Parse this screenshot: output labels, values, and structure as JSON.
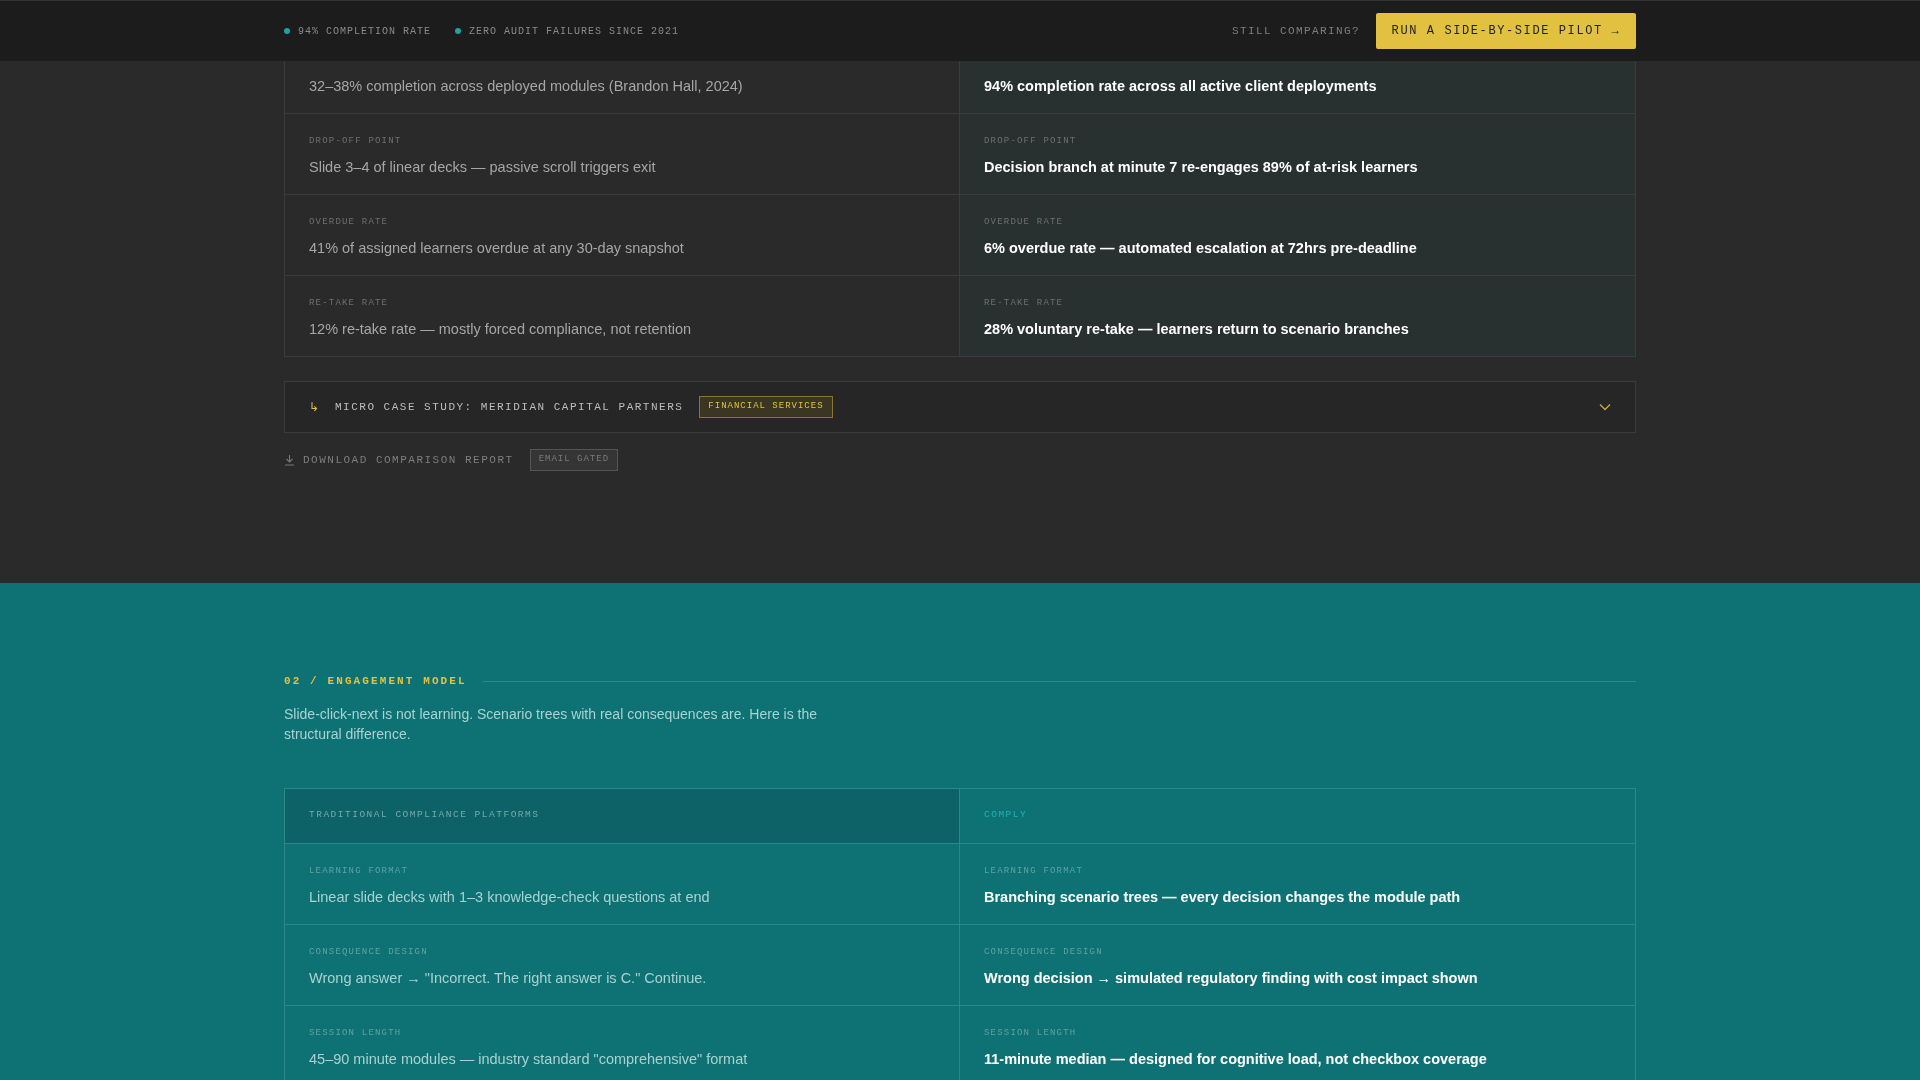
{
  "top_bar": {
    "stats": [
      "94% COMPLETION RATE",
      "ZERO AUDIT FAILURES SINCE 2021"
    ],
    "prompt": "STILL COMPARING?",
    "cta": "RUN A SIDE-BY-SIDE PILOT →"
  },
  "comparison": {
    "rows": [
      {
        "left": {
          "value": "32–38% completion across deployed modules (Brandon Hall, 2024)"
        },
        "right": {
          "value": "94% completion rate across all active client deployments"
        }
      },
      {
        "left": {
          "label": "DROP-OFF POINT",
          "value": "Slide 3–4 of linear decks — passive scroll triggers exit"
        },
        "right": {
          "label": "DROP-OFF POINT",
          "value": "Decision branch at minute 7 re-engages 89% of at-risk learners"
        }
      },
      {
        "left": {
          "label": "OVERDUE RATE",
          "value": "41% of assigned learners overdue at any 30-day snapshot"
        },
        "right": {
          "label": "OVERDUE RATE",
          "value": "6% overdue rate — automated escalation at 72hrs pre-deadline"
        }
      },
      {
        "left": {
          "label": "RE-TAKE RATE",
          "value": "12% re-take rate — mostly forced compliance, not retention"
        },
        "right": {
          "label": "RE-TAKE RATE",
          "value": "28% voluntary re-take — learners return to scenario branches"
        }
      }
    ]
  },
  "case_study": {
    "icon": "↳",
    "title": "MICRO CASE STUDY: MERIDIAN CAPITAL PARTNERS",
    "tag": "FINANCIAL SERVICES",
    "expanded": false
  },
  "download": {
    "label": "DOWNLOAD COMPARISON REPORT",
    "tag": "EMAIL GATED"
  },
  "section": {
    "heading": "02 / ENGAGEMENT MODEL",
    "description": "Slide-click-next is not learning. Scenario trees with real consequences are. Here is the structural difference.",
    "table": {
      "columns": [
        "TRADITIONAL COMPLIANCE PLATFORMS",
        "COMPLY"
      ],
      "rows": [
        {
          "left": {
            "label": "LEARNING FORMAT",
            "value": "Linear slide decks with 1–3 knowledge-check questions at end"
          },
          "right": {
            "label": "LEARNING FORMAT",
            "value": "Branching scenario trees — every decision changes the module path"
          }
        },
        {
          "left": {
            "label": "CONSEQUENCE DESIGN",
            "value": "Wrong answer → \"Incorrect. The right answer is C.\" Continue."
          },
          "right": {
            "label": "CONSEQUENCE DESIGN",
            "value": "Wrong decision → simulated regulatory finding with cost impact shown"
          }
        },
        {
          "left": {
            "label": "SESSION LENGTH",
            "value": "45–90 minute modules — industry standard \"comprehensive\" format"
          },
          "right": {
            "label": "SESSION LENGTH",
            "value": "11-minute median — designed for cognitive load, not checkbox coverage"
          }
        }
      ]
    }
  }
}
